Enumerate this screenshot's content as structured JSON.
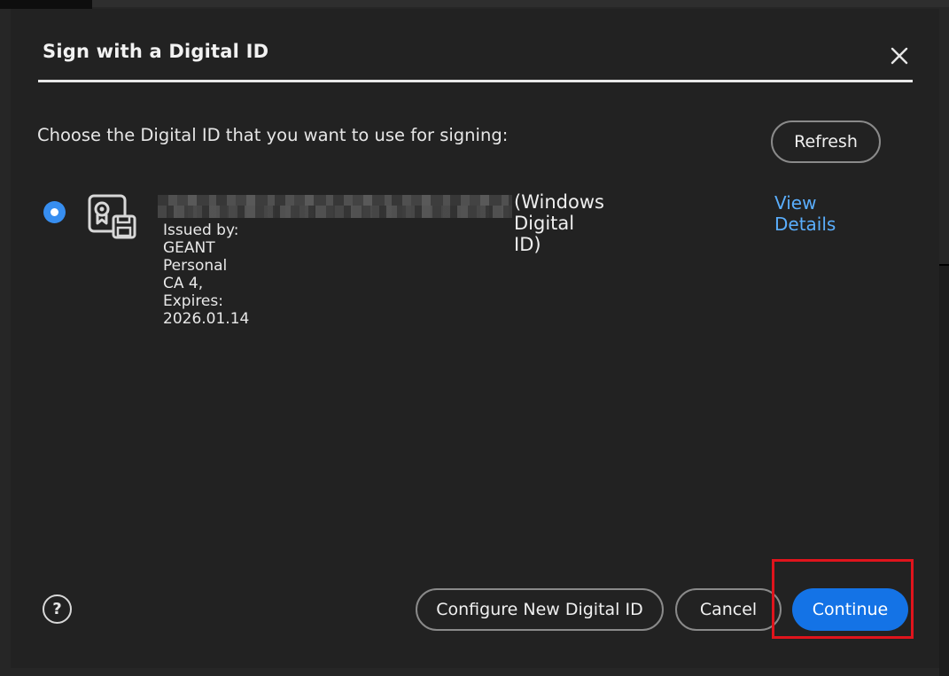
{
  "dialog": {
    "title": "Sign with a Digital ID",
    "prompt": "Choose the Digital ID that you want to use for signing:",
    "refresh_label": "Refresh",
    "close_icon": "close-icon"
  },
  "digital_id": {
    "selected": true,
    "icon": "certificate-icon",
    "type_label": "(Windows Digital ID)",
    "issuer_line": "Issued by: GEANT Personal CA 4, Expires: 2026.01.14",
    "view_details_label": "View Details"
  },
  "footer": {
    "help_icon": "help-icon",
    "help_glyph": "?",
    "configure_label": "Configure New Digital ID",
    "cancel_label": "Cancel",
    "continue_label": "Continue"
  },
  "colors": {
    "dialog_bg": "#222222",
    "accent": "#1473e6",
    "link": "#5aaefd",
    "radio": "#378ef0",
    "highlight": "#e0141c"
  }
}
